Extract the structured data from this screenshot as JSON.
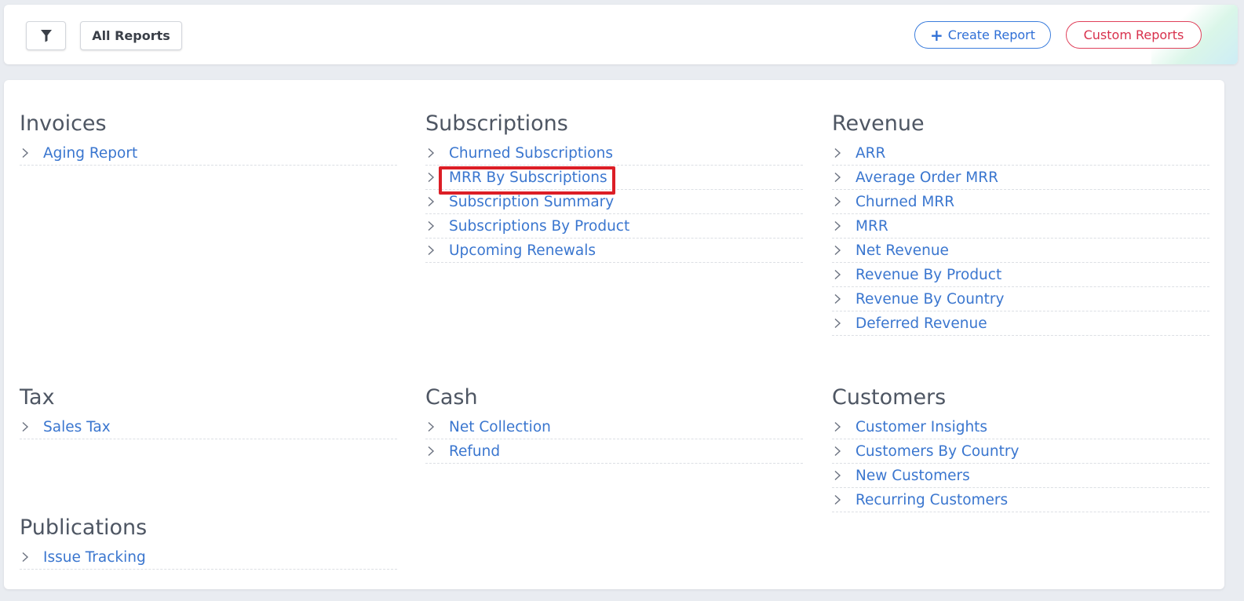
{
  "toolbar": {
    "all_reports_label": "All Reports",
    "create_report_label": "Create Report",
    "create_report_icon": "+",
    "custom_reports_label": "Custom Reports"
  },
  "colors": {
    "link": "#3a76cf",
    "primary": "#2f6fd6",
    "danger": "#d8304c",
    "highlight": "#dc1e26"
  },
  "sections": {
    "invoices": {
      "title": "Invoices",
      "items": [
        "Aging Report"
      ]
    },
    "subscriptions": {
      "title": "Subscriptions",
      "items": [
        "Churned Subscriptions",
        "MRR By Subscriptions",
        "Subscription Summary",
        "Subscriptions By Product",
        "Upcoming Renewals"
      ]
    },
    "revenue": {
      "title": "Revenue",
      "items": [
        "ARR",
        "Average Order MRR",
        "Churned MRR",
        "MRR",
        "Net Revenue",
        "Revenue By Product",
        "Revenue By Country",
        "Deferred Revenue"
      ]
    },
    "tax": {
      "title": "Tax",
      "items": [
        "Sales Tax"
      ]
    },
    "cash": {
      "title": "Cash",
      "items": [
        "Net Collection",
        "Refund"
      ]
    },
    "customers": {
      "title": "Customers",
      "items": [
        "Customer Insights",
        "Customers By Country",
        "New Customers",
        "Recurring Customers"
      ]
    },
    "publications": {
      "title": "Publications",
      "items": [
        "Issue Tracking"
      ]
    }
  }
}
